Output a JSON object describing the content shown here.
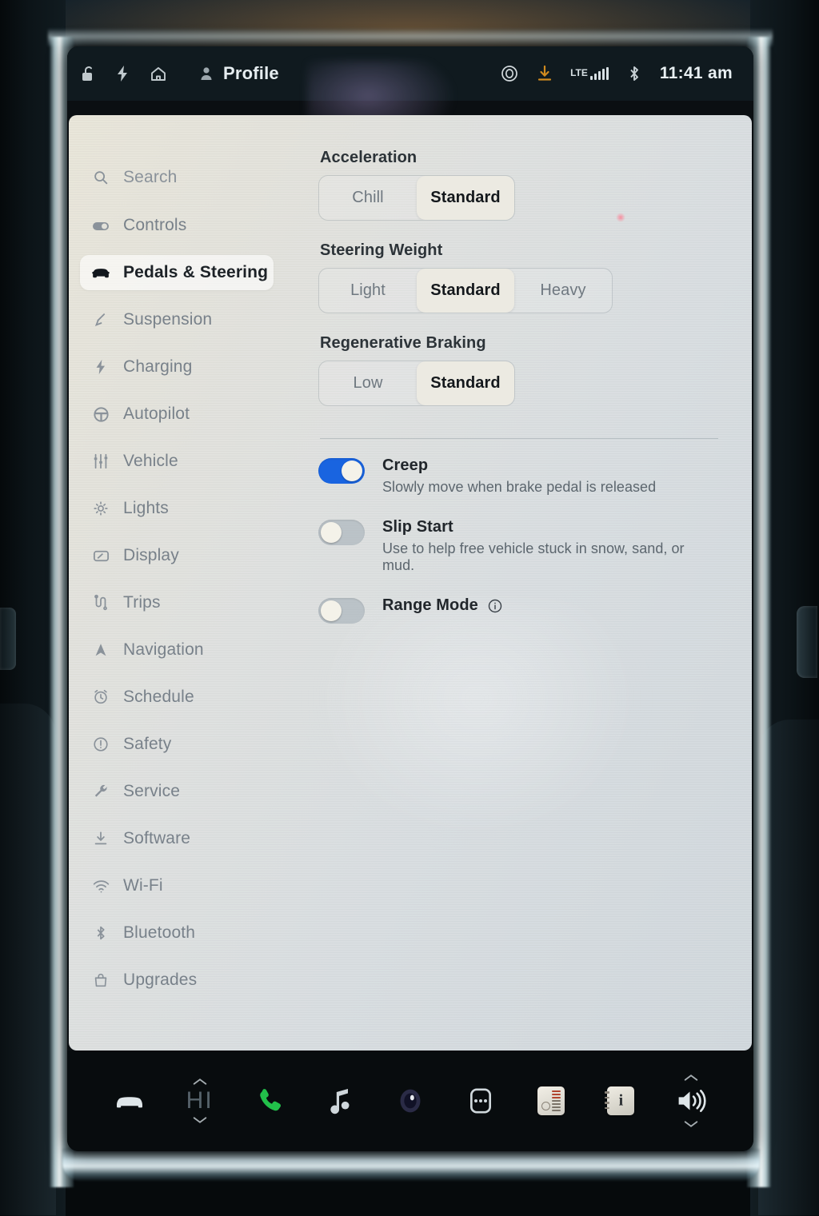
{
  "status_bar": {
    "left_icons": [
      "lock-open-icon",
      "lightning-bolt-icon",
      "home-icon"
    ],
    "profile_label": "Profile",
    "right_icons": [
      "dashcam-circle-icon",
      "download-arrow-icon"
    ],
    "network_label": "LTE",
    "signal_bars": 5,
    "bluetooth_icon": "bluetooth-icon",
    "time": "11:41 am"
  },
  "sidebar": {
    "items": [
      {
        "label": "Search",
        "icon": "search-icon",
        "active": false
      },
      {
        "label": "Controls",
        "icon": "toggle-icon",
        "active": false
      },
      {
        "label": "Pedals & Steering",
        "icon": "car-front-icon",
        "active": true
      },
      {
        "label": "Suspension",
        "icon": "shock-absorber-icon",
        "active": false
      },
      {
        "label": "Charging",
        "icon": "lightning-bolt-icon",
        "active": false
      },
      {
        "label": "Autopilot",
        "icon": "steering-wheel-icon",
        "active": false
      },
      {
        "label": "Vehicle",
        "icon": "sliders-icon",
        "active": false
      },
      {
        "label": "Lights",
        "icon": "headlight-icon",
        "active": false
      },
      {
        "label": "Display",
        "icon": "screen-icon",
        "active": false
      },
      {
        "label": "Trips",
        "icon": "route-icon",
        "active": false
      },
      {
        "label": "Navigation",
        "icon": "navigation-arrow-icon",
        "active": false
      },
      {
        "label": "Schedule",
        "icon": "alarm-clock-icon",
        "active": false
      },
      {
        "label": "Safety",
        "icon": "exclamation-circle-icon",
        "active": false
      },
      {
        "label": "Service",
        "icon": "wrench-icon",
        "active": false
      },
      {
        "label": "Software",
        "icon": "download-icon",
        "active": false
      },
      {
        "label": "Wi-Fi",
        "icon": "wifi-icon",
        "active": false
      },
      {
        "label": "Bluetooth",
        "icon": "bluetooth-icon",
        "active": false
      },
      {
        "label": "Upgrades",
        "icon": "bag-icon",
        "active": false
      }
    ]
  },
  "content": {
    "groups": [
      {
        "label": "Acceleration",
        "options": [
          {
            "label": "Chill",
            "selected": false
          },
          {
            "label": "Standard",
            "selected": true
          }
        ]
      },
      {
        "label": "Steering Weight",
        "options": [
          {
            "label": "Light",
            "selected": false
          },
          {
            "label": "Standard",
            "selected": true
          },
          {
            "label": "Heavy",
            "selected": false
          }
        ]
      },
      {
        "label": "Regenerative Braking",
        "options": [
          {
            "label": "Low",
            "selected": false
          },
          {
            "label": "Standard",
            "selected": true
          }
        ]
      }
    ],
    "toggles": [
      {
        "title": "Creep",
        "subtitle": "Slowly move when brake pedal is released",
        "on": true,
        "has_info": false
      },
      {
        "title": "Slip Start",
        "subtitle": "Use to help free vehicle stuck in snow, sand, or mud.",
        "on": false,
        "has_info": false
      },
      {
        "title": "Range Mode",
        "subtitle": "",
        "on": false,
        "has_info": true
      }
    ]
  },
  "taskbar": {
    "car_icon": "car-icon",
    "climate_left_temp": "HI",
    "items": [
      {
        "icon": "phone-icon"
      },
      {
        "icon": "music-note-icon"
      },
      {
        "icon": "camera-icon"
      },
      {
        "icon": "more-dots-icon"
      },
      {
        "icon": "climate-card-icon"
      },
      {
        "icon": "info-card-icon"
      }
    ],
    "volume_icon": "volume-icon"
  },
  "colors": {
    "accent_blue": "#1964e0",
    "panel_bg": "#dfe1e0",
    "status_bar_bg": "#101a1f",
    "taskbar_bg": "#080c0e",
    "phone_green": "#22c04a",
    "download_orange": "#e2951f"
  }
}
